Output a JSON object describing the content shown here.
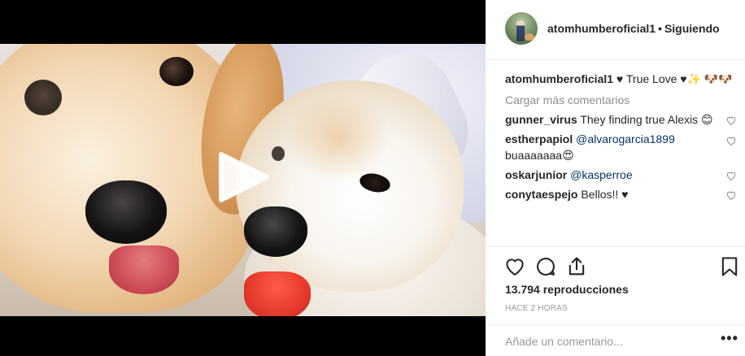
{
  "post": {
    "author": "atomhumberoficial1",
    "separator": "•",
    "follow_status": "Siguiendo",
    "caption_username": "atomhumberoficial1",
    "caption_text": "♥ True Love ♥✨ 🐶🐶",
    "load_more_label": "Cargar más comentarios",
    "comments": [
      {
        "username": "gunner_virus",
        "mention": "",
        "text": "They finding true Alexis 😊"
      },
      {
        "username": "estherpapiol",
        "mention": "@alvarogarcia1899",
        "text": "buaaaaaaa😍"
      },
      {
        "username": "oskarjunior",
        "mention": "@kasperroe",
        "text": ""
      },
      {
        "username": "conytaespejo",
        "mention": "",
        "text": "Bellos!! ♥"
      }
    ],
    "views": "13.794 reproducciones",
    "time": "HACE 2 HORAS",
    "comment_placeholder": "Añade un comentario...",
    "more_options": "•••"
  },
  "icons": {
    "play": "play-icon",
    "like": "heart-icon",
    "comment": "comment-icon",
    "share": "share-icon",
    "save": "bookmark-icon",
    "comment_like": "small-heart-icon"
  },
  "colors": {
    "text": "#262626",
    "muted": "#8e8e8e",
    "link": "#003569",
    "divider": "#efefef"
  }
}
